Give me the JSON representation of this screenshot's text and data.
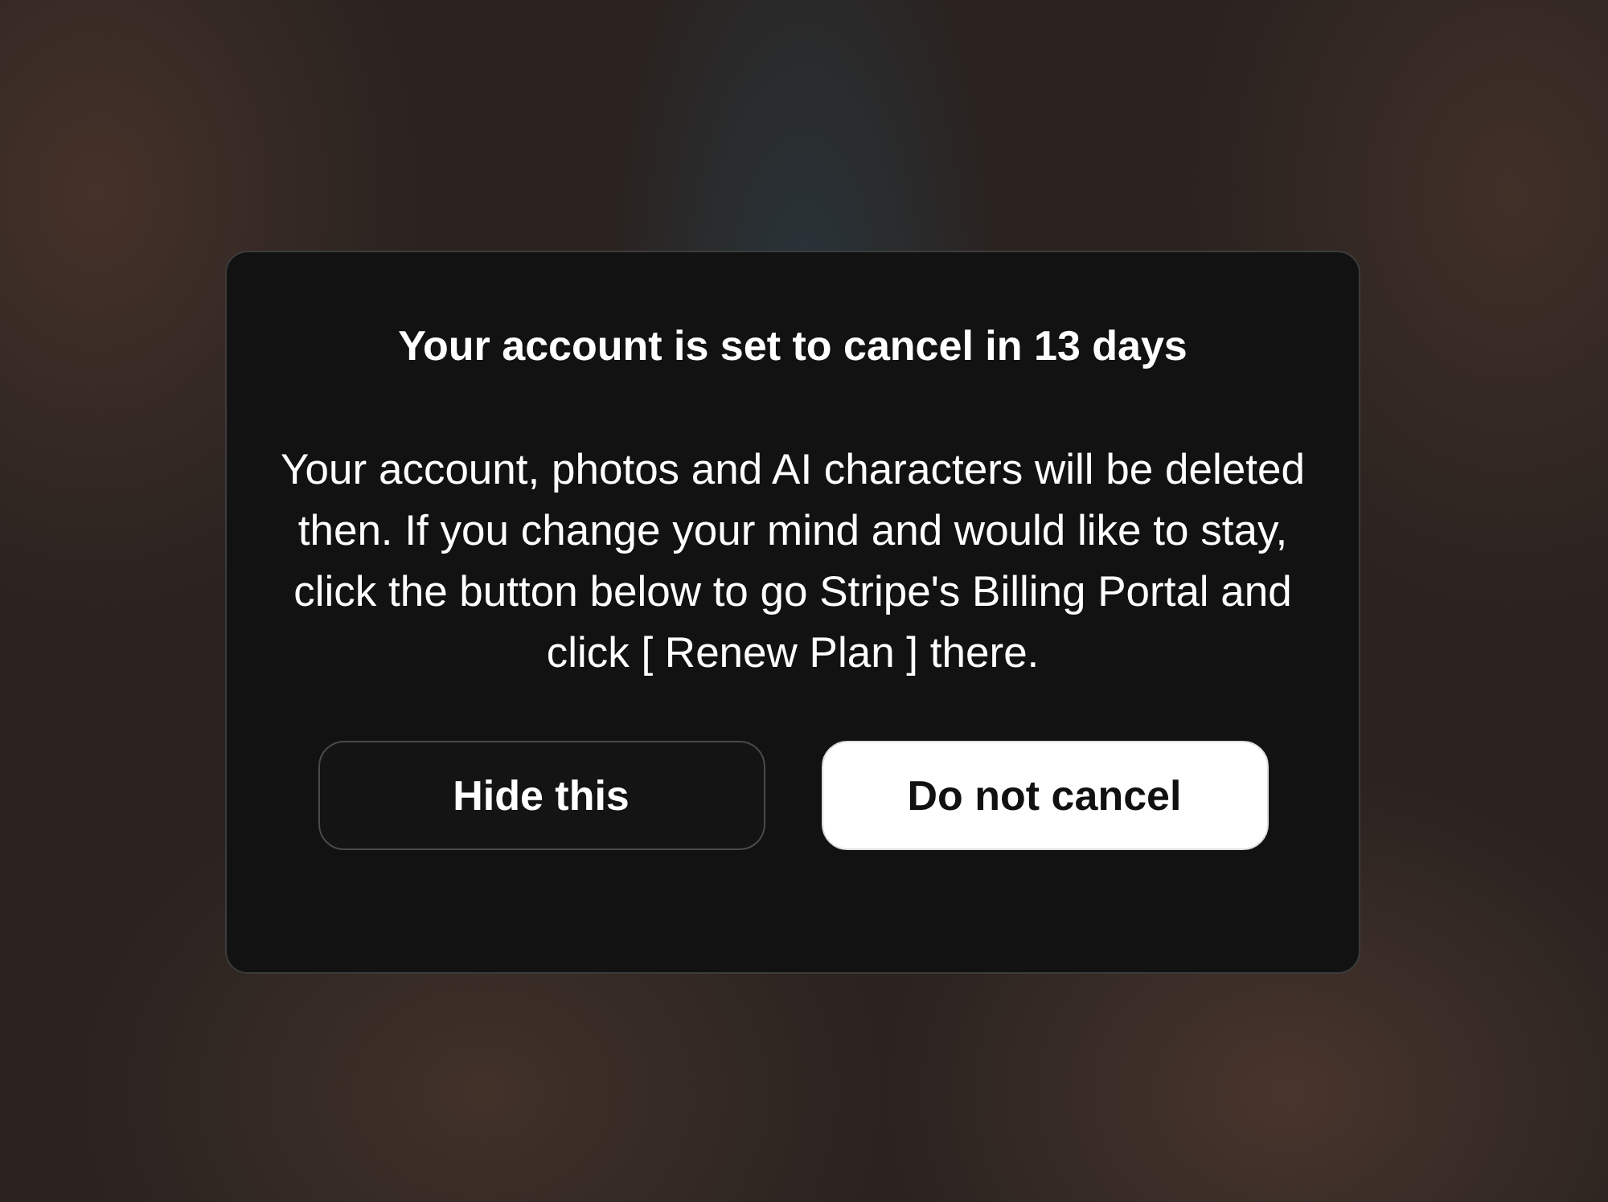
{
  "dialog": {
    "title": "Your account is set to cancel in 13 days",
    "message": "Your account, photos and AI characters will be deleted then. If you change your mind and would like to stay, click the button below to go Stripe's Billing Portal and click [ Renew Plan ] there.",
    "buttons": [
      {
        "label": "Hide this",
        "kind": "secondary"
      },
      {
        "label": "Do not cancel",
        "kind": "primary"
      }
    ]
  }
}
